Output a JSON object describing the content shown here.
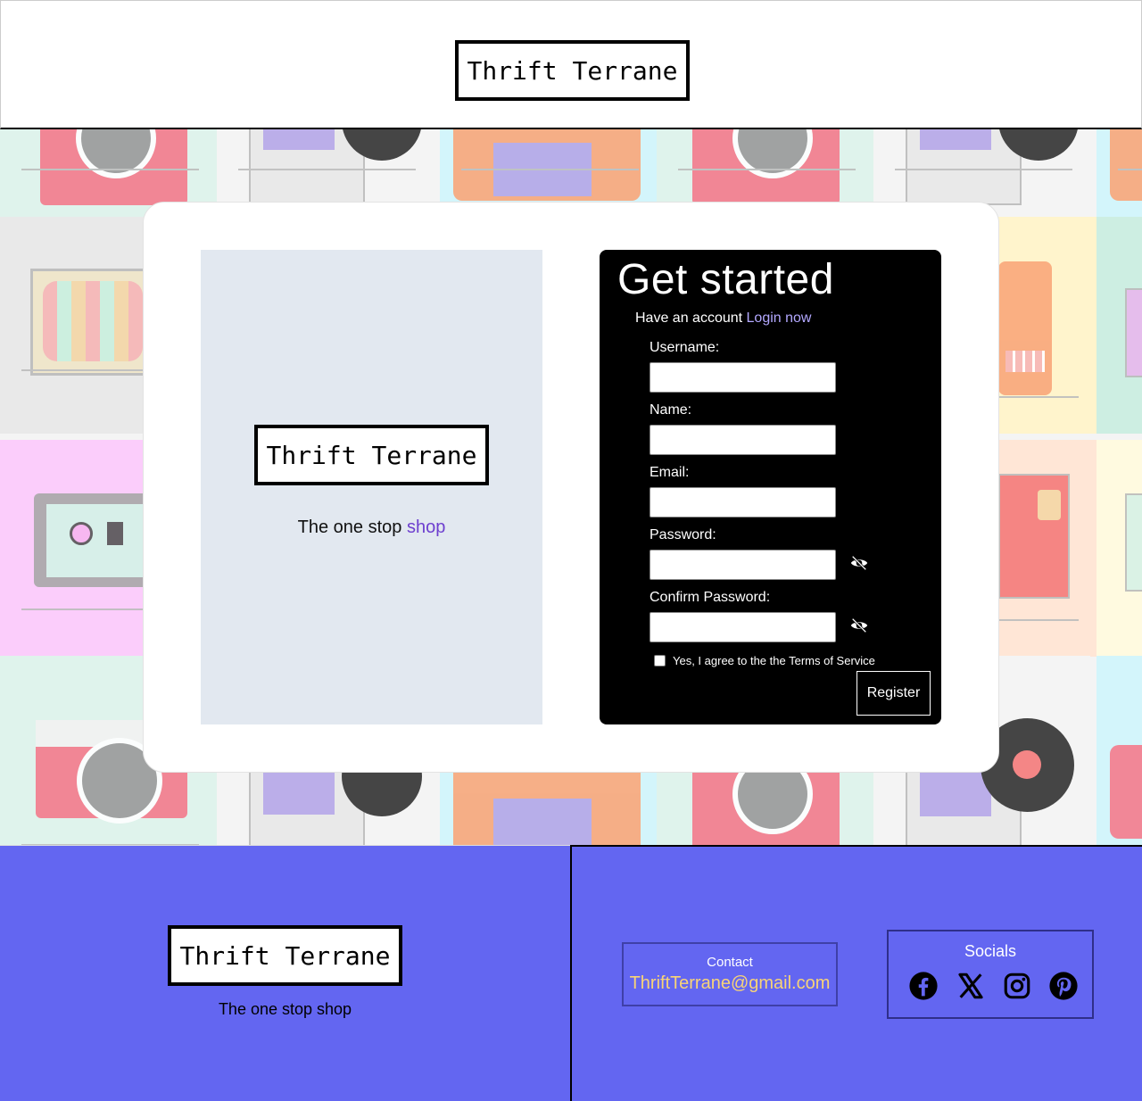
{
  "header": {
    "logo_text": "Thrift Terrane"
  },
  "promo": {
    "logo_text": "Thrift Terrane",
    "tagline_prefix": "The one stop ",
    "tagline_accent": "shop"
  },
  "form": {
    "title": "Get started",
    "have_account_text": "Have an account ",
    "login_link": "Login now",
    "fields": {
      "username_label": "Username:",
      "name_label": "Name:",
      "email_label": "Email:",
      "password_label": "Password:",
      "confirm_password_label": "Confirm Password:"
    },
    "terms_label": "Yes, I agree to the the Terms of Service",
    "register_label": "Register"
  },
  "footer": {
    "logo_text": "Thrift Terrane",
    "tagline": "The one stop shop",
    "contact_title": "Contact",
    "contact_email": "ThriftTerrane@gmail.com",
    "socials_title": "Socials",
    "social_icons": [
      "facebook-icon",
      "x-icon",
      "instagram-icon",
      "pinterest-icon"
    ]
  },
  "colors": {
    "footer_bg": "#6366f1",
    "email_color": "#f8d477",
    "promo_bg": "#e2e8f0",
    "accent_purple": "#6d3fcf",
    "login_link": "#b3a8ff"
  }
}
